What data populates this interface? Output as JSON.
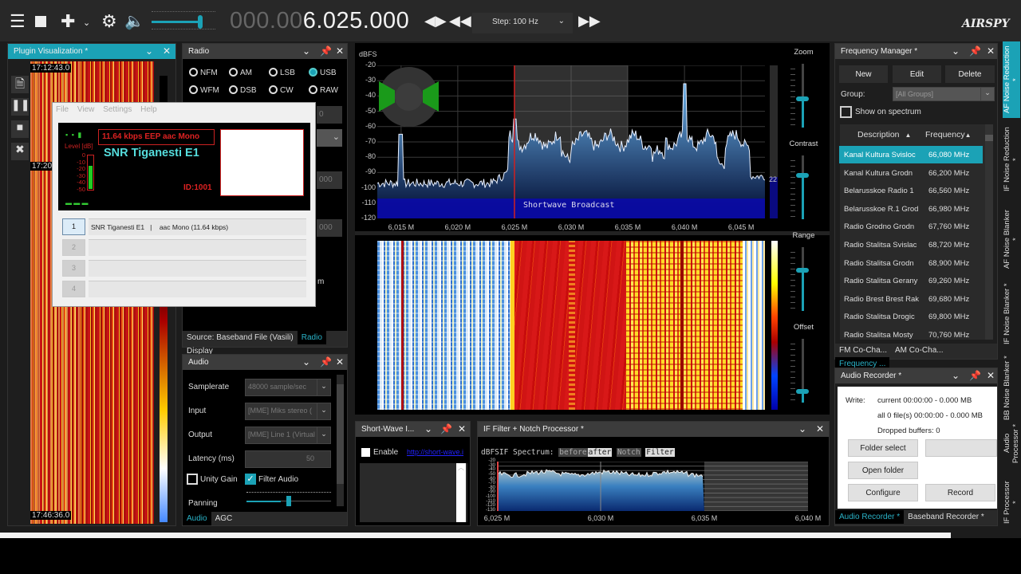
{
  "toolbar": {
    "freq_dim": "000.00",
    "freq_main": "6.025.000",
    "step": "Step: 100 Hz",
    "logo": "AIRSPY"
  },
  "plugin_vis": {
    "title": "Plugin Visualization *",
    "ts_top": "17:12:43.0",
    "ts_mid": "17:20",
    "ts_bottom": "17:46:36.0"
  },
  "radio": {
    "title": "Radio",
    "modes": [
      "NFM",
      "AM",
      "LSB",
      "USB",
      "WFM",
      "DSB",
      "CW",
      "RAW"
    ],
    "selected": "USB",
    "spin1": "0",
    "spin2": "000",
    "spin3": "000",
    "partial": "m",
    "tabs": [
      "Source: Baseband File (Vasili)",
      "Radio",
      "Display"
    ]
  },
  "drm": {
    "menu": [
      "File",
      "View",
      "Settings",
      "Help"
    ],
    "bitrate": "11.64 kbps EEP aac Mono",
    "station": "SNR Tiganesti E1",
    "id": "ID:1001",
    "level_label": "Level [dB]",
    "level_ticks": [
      "0",
      "-10",
      "-20",
      "-30",
      "-40",
      "-50"
    ],
    "level_fraction": 0.7,
    "services": [
      {
        "n": "1",
        "text": "SNR Tiganesti E1   |    aac Mono (11.64 kbps)"
      },
      {
        "n": "2",
        "text": ""
      },
      {
        "n": "3",
        "text": ""
      },
      {
        "n": "4",
        "text": ""
      }
    ]
  },
  "audio": {
    "title": "Audio",
    "samplerate_label": "Samplerate",
    "samplerate": "48000 sample/sec",
    "input_label": "Input",
    "input": "[MME] Miks stereo (",
    "output_label": "Output",
    "output": "[MME] Line 1 (Virtual",
    "latency_label": "Latency (ms)",
    "latency": "50",
    "unity_gain": "Unity Gain",
    "unity_gain_checked": false,
    "filter_audio": "Filter Audio",
    "filter_audio_checked": true,
    "panning_label": "Panning",
    "panning": 0.5,
    "tabs": [
      "Audio",
      "AGC"
    ]
  },
  "spectrum": {
    "unit": "dBFS",
    "y_ticks": [
      "-20",
      "-30",
      "-40",
      "-50",
      "-60",
      "-70",
      "-80",
      "-90",
      "-100",
      "-110",
      "-120"
    ],
    "x_ticks": [
      "6,015 M",
      "6,020 M",
      "6,025 M",
      "6,030 M",
      "6,035 M",
      "6,040 M",
      "6,045 M"
    ],
    "band_label": "Shortwave Broadcast",
    "level_value": "22",
    "controls": [
      "Zoom",
      "Contrast",
      "Range",
      "Offset"
    ],
    "control_levels": [
      0.55,
      0.3,
      0.35,
      0.85
    ]
  },
  "shortwave": {
    "title": "Short-Wave I...",
    "enable": "Enable",
    "link": "http://short-wave.i"
  },
  "if_filter": {
    "title": "IF Filter + Notch Processor *",
    "label_unit": "dBFS",
    "label": "IF Spectrum:",
    "buttons": [
      "before",
      "after",
      "Notch",
      "Filter"
    ],
    "y_ticks": [
      "-20",
      "-30",
      "-40",
      "-50",
      "-60",
      "-70",
      "-80",
      "-90",
      "-100",
      "-110",
      "-120",
      "-130"
    ],
    "x_ticks": [
      "6,025 M",
      "6,030 M",
      "6,035 M",
      "6,040 M"
    ]
  },
  "freq_manager": {
    "title": "Frequency Manager *",
    "new": "New",
    "edit": "Edit",
    "delete": "Delete",
    "group_label": "Group:",
    "group": "[All Groups]",
    "show_on_spectrum": "Show on spectrum",
    "col_desc": "Description",
    "col_freq": "Frequency",
    "rows": [
      [
        "Kanal Kultura Svisloc",
        "66,080 MHz"
      ],
      [
        "Kanal Kultura Grodn",
        "66,200 MHz"
      ],
      [
        "Belarusskoe Radio 1",
        "66,560 MHz"
      ],
      [
        "Belarusskoe R.1 Grod",
        "66,980 MHz"
      ],
      [
        "Radio Grodno Grodn",
        "67,760 MHz"
      ],
      [
        "Radio Stalitsa Svislac",
        "68,720 MHz"
      ],
      [
        "Radio Stalitsa Grodn",
        "68,900 MHz"
      ],
      [
        "Radio Stalitsa Gerany",
        "69,260 MHz"
      ],
      [
        "Radio Brest Brest Rak",
        "69,680 MHz"
      ],
      [
        "Radio Stalitsa Drogic",
        "69,800 MHz"
      ],
      [
        "Radio Stalitsa Mosty",
        "70,760 MHz"
      ]
    ],
    "tabs": [
      "FM Co-Cha...",
      "AM Co-Cha...",
      "Frequency ..."
    ]
  },
  "recorder": {
    "title": "Audio Recorder *",
    "write": "Write:",
    "current": "current 00:00:00 - 0.000 MB",
    "all": "all 0 file(s) 00:00:00 - 0.000 MB",
    "dropped": "Dropped buffers: 0",
    "folder_select": "Folder select",
    "open_folder": "Open folder",
    "configure": "Configure",
    "record": "Record",
    "tabs": [
      "Audio Recorder *",
      "Baseband Recorder *"
    ]
  },
  "side_tabs": [
    "AF Noise Reduction *",
    "IF Noise Reduction *",
    "AF Noise Blanker *",
    "IF Noise Blanker *",
    "BB Noise Blanker *",
    "Audio Processor *",
    "IF Processor *"
  ],
  "colors": {
    "accent": "#1ba2b6",
    "band": "#0a0aa8",
    "marker": "#d02020"
  }
}
